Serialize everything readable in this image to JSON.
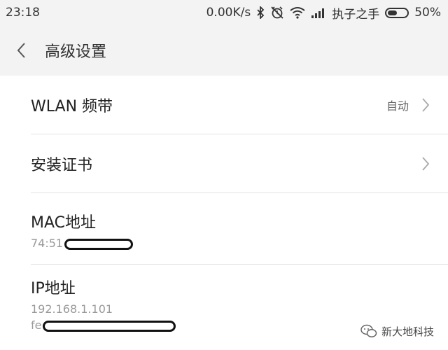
{
  "status_bar": {
    "time": "23:18",
    "net_speed": "0.00K/s",
    "carrier": "执子之手",
    "battery": "50%",
    "battery_level": 0.5
  },
  "header": {
    "title": "高级设置"
  },
  "settings": {
    "wlan_band": {
      "label": "WLAN 频带",
      "value": "自动"
    },
    "install_cert": {
      "label": "安装证书"
    },
    "mac": {
      "label": "MAC地址",
      "value_prefix": "74:51"
    },
    "ip": {
      "label": "IP地址",
      "ipv4": "192.168.1.101",
      "ipv6_prefix": "fe"
    }
  },
  "watermark": {
    "text": "新大地科技"
  }
}
